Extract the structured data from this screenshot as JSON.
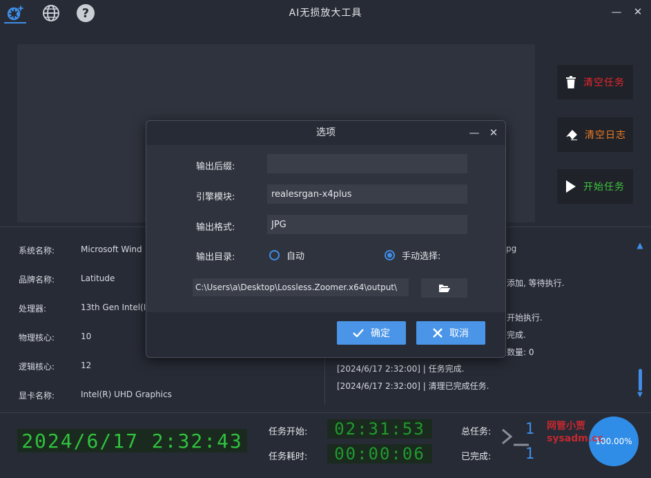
{
  "app": {
    "title": "AI无损放大工具",
    "tabs": [
      {
        "icon": "gear-sparkle-icon",
        "active": true
      },
      {
        "icon": "globe-icon",
        "active": false
      },
      {
        "icon": "help-icon",
        "active": false
      }
    ],
    "window_controls": {
      "minimize": "—",
      "close": "✕"
    }
  },
  "sidebar_buttons": {
    "clear_tasks": {
      "label": "清空任务",
      "color": "#e8262d",
      "icon": "trash-icon"
    },
    "clear_log": {
      "label": "清空日志",
      "color": "#f07c22",
      "icon": "eraser-icon"
    },
    "start_tasks": {
      "label": "开始任务",
      "color": "#3ec63c",
      "icon": "play-icon"
    }
  },
  "system_info": [
    {
      "key": "系统名称:",
      "value": "Microsoft Wind"
    },
    {
      "key": "品牌名称:",
      "value": "Latitude"
    },
    {
      "key": "处理器:",
      "value": "13th Gen Intel(I"
    },
    {
      "key": "物理核心:",
      "value": "10"
    },
    {
      "key": "逻辑核心:",
      "value": "12"
    },
    {
      "key": "显卡名称:",
      "value": "Intel(R) UHD Graphics"
    }
  ],
  "log": [
    "pg",
    "添加, 等待执行.",
    "开始执行.",
    "完成.",
    "数量: 0",
    "[2024/6/17 2:32:00] | 任务完成.",
    "[2024/6/17 2:32:00] | 清理已完成任务."
  ],
  "bottom": {
    "clock": "2024/6/17 2:32:43",
    "task_start_label": "任务开始:",
    "task_start_value": "02:31:53",
    "task_elapsed_label": "任务耗时:",
    "task_elapsed_value": "00:00:06",
    "total_tasks_label": "总任务:",
    "total_tasks_value": "1",
    "completed_label": "已完成:",
    "completed_value": "1",
    "percent": "100.00%",
    "percent_value": 100.0,
    "watermark": [
      "网管小贾",
      "sysadm.cc"
    ]
  },
  "dialog": {
    "title": "选项",
    "controls": {
      "minimize": "—",
      "close": "✕"
    },
    "fields": {
      "suffix": {
        "label": "输出后缀:",
        "value": ""
      },
      "engine": {
        "label": "引擎模块:",
        "value": "realesrgan-x4plus"
      },
      "format": {
        "label": "输出格式:",
        "value": "JPG"
      },
      "output_dir": {
        "label": "输出目录:",
        "auto_label": "自动",
        "manual_label": "手动选择:",
        "selected": "manual",
        "path": "C:\\Users\\a\\Desktop\\Lossless.Zoomer.x64\\output\\"
      }
    },
    "ok_label": "确定",
    "cancel_label": "取消"
  },
  "colors": {
    "accent": "#3f8ee8",
    "background": "#272b35",
    "lcd_green": "#2fc23f"
  }
}
